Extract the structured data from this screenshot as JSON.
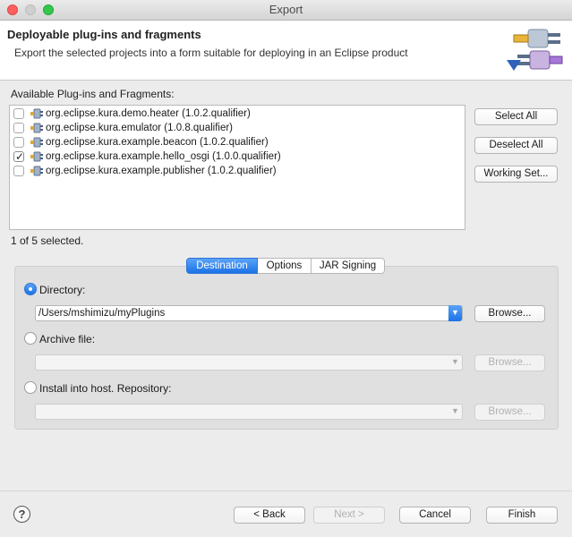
{
  "window": {
    "title": "Export"
  },
  "banner": {
    "title": "Deployable plug-ins and fragments",
    "description": "Export the selected projects into a form suitable for deploying in an Eclipse product"
  },
  "plugins": {
    "label": "Available Plug-ins and Fragments:",
    "items": [
      {
        "name": "org.eclipse.kura.demo.heater (1.0.2.qualifier)",
        "checked": false
      },
      {
        "name": "org.eclipse.kura.emulator (1.0.8.qualifier)",
        "checked": false
      },
      {
        "name": "org.eclipse.kura.example.beacon (1.0.2.qualifier)",
        "checked": false
      },
      {
        "name": "org.eclipse.kura.example.hello_osgi (1.0.0.qualifier)",
        "checked": true
      },
      {
        "name": "org.eclipse.kura.example.publisher (1.0.2.qualifier)",
        "checked": false
      }
    ],
    "selected_count": "1 of 5 selected."
  },
  "side_buttons": {
    "select_all": "Select All",
    "deselect_all": "Deselect All",
    "working_set": "Working Set..."
  },
  "tabs": [
    {
      "label": "Destination",
      "active": true
    },
    {
      "label": "Options",
      "active": false
    },
    {
      "label": "JAR Signing",
      "active": false
    }
  ],
  "destination": {
    "directory_label": "Directory:",
    "directory_value": "/Users/mshimizu/myPlugins",
    "archive_label": "Archive file:",
    "archive_value": "",
    "repository_label": "Install into host. Repository:",
    "repository_value": "",
    "browse_label": "Browse...",
    "selected_option": "Directory"
  },
  "footer": {
    "back": "< Back",
    "next": "Next >",
    "cancel": "Cancel",
    "finish": "Finish"
  },
  "colors": {
    "accent": "#1b72e8",
    "window_bg": "#ececec"
  },
  "icons": [
    "help-icon",
    "plugin-icon",
    "banner-plugin-icon"
  ]
}
